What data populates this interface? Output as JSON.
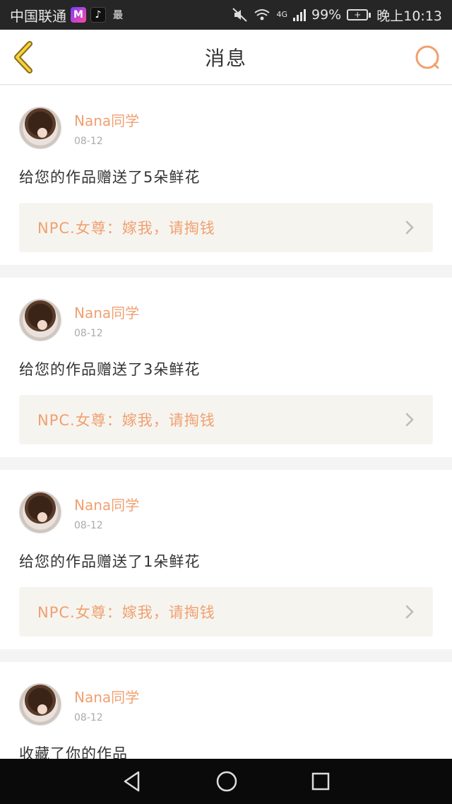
{
  "status_bar": {
    "carrier": "中国联通",
    "app_icons": [
      "M",
      "♪",
      "最"
    ],
    "network": "4G",
    "battery": "99%",
    "time": "晚上10:13"
  },
  "header": {
    "title": "消息",
    "back_icon": "chevron-left-icon",
    "search_icon": "search-icon",
    "accent_color": "#f0a070"
  },
  "messages": [
    {
      "name": "Nana同学",
      "date": "08-12",
      "text": "给您的作品赠送了5朵鲜花",
      "quote": "NPC.女尊：嫁我，请掏钱"
    },
    {
      "name": "Nana同学",
      "date": "08-12",
      "text": "给您的作品赠送了3朵鲜花",
      "quote": "NPC.女尊：嫁我，请掏钱"
    },
    {
      "name": "Nana同学",
      "date": "08-12",
      "text": "给您的作品赠送了1朵鲜花",
      "quote": "NPC.女尊：嫁我，请掏钱"
    },
    {
      "name": "Nana同学",
      "date": "08-12",
      "text": "收藏了你的作品"
    }
  ]
}
